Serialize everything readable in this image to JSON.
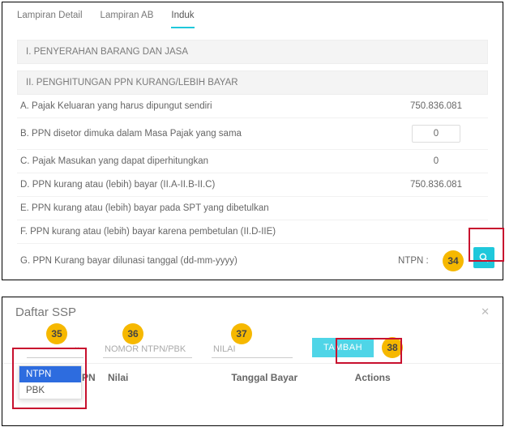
{
  "tabs": {
    "lampiran_detail": "Lampiran Detail",
    "lampiran_ab": "Lampiran AB",
    "induk": "Induk"
  },
  "sections": {
    "s1": "I. PENYERAHAN BARANG DAN JASA",
    "s2": "II. PENGHITUNGAN PPN KURANG/LEBIH BAYAR"
  },
  "rows": {
    "a": {
      "label": "A. Pajak Keluaran yang harus dipungut sendiri",
      "value": "750.836.081"
    },
    "b": {
      "label": "B. PPN disetor dimuka dalam Masa Pajak yang sama",
      "value": "0"
    },
    "c": {
      "label": "C. Pajak Masukan yang dapat diperhitungkan",
      "value": "0"
    },
    "d": {
      "label": "D. PPN kurang atau (lebih) bayar (II.A-II.B-II.C)",
      "value": "750.836.081"
    },
    "e": {
      "label": "E. PPN kurang atau (lebih) bayar pada SPT yang dibetulkan"
    },
    "f": {
      "label": "F. PPN kurang atau (lebih) bayar karena pembetulan (II.D-IIE)"
    },
    "g": {
      "label": "G. PPN Kurang bayar dilunasi tanggal (dd-mm-yyyy)",
      "ntpn_label": "NTPN :"
    }
  },
  "badges": {
    "b34": "34",
    "b35": "35",
    "b36": "36",
    "b37": "37",
    "b38": "38"
  },
  "ssp": {
    "title": "Daftar SSP",
    "nomor_placeholder": "NOMOR NTPN/PBK",
    "nilai_placeholder": "NILAI",
    "tambah_label": "TAMBAH",
    "dropdown": {
      "opt1": "NTPN",
      "opt2": "PBK"
    },
    "columns": {
      "c1": "PN",
      "c2": "Nilai",
      "c3": "Tanggal Bayar",
      "c4": "Actions"
    }
  }
}
